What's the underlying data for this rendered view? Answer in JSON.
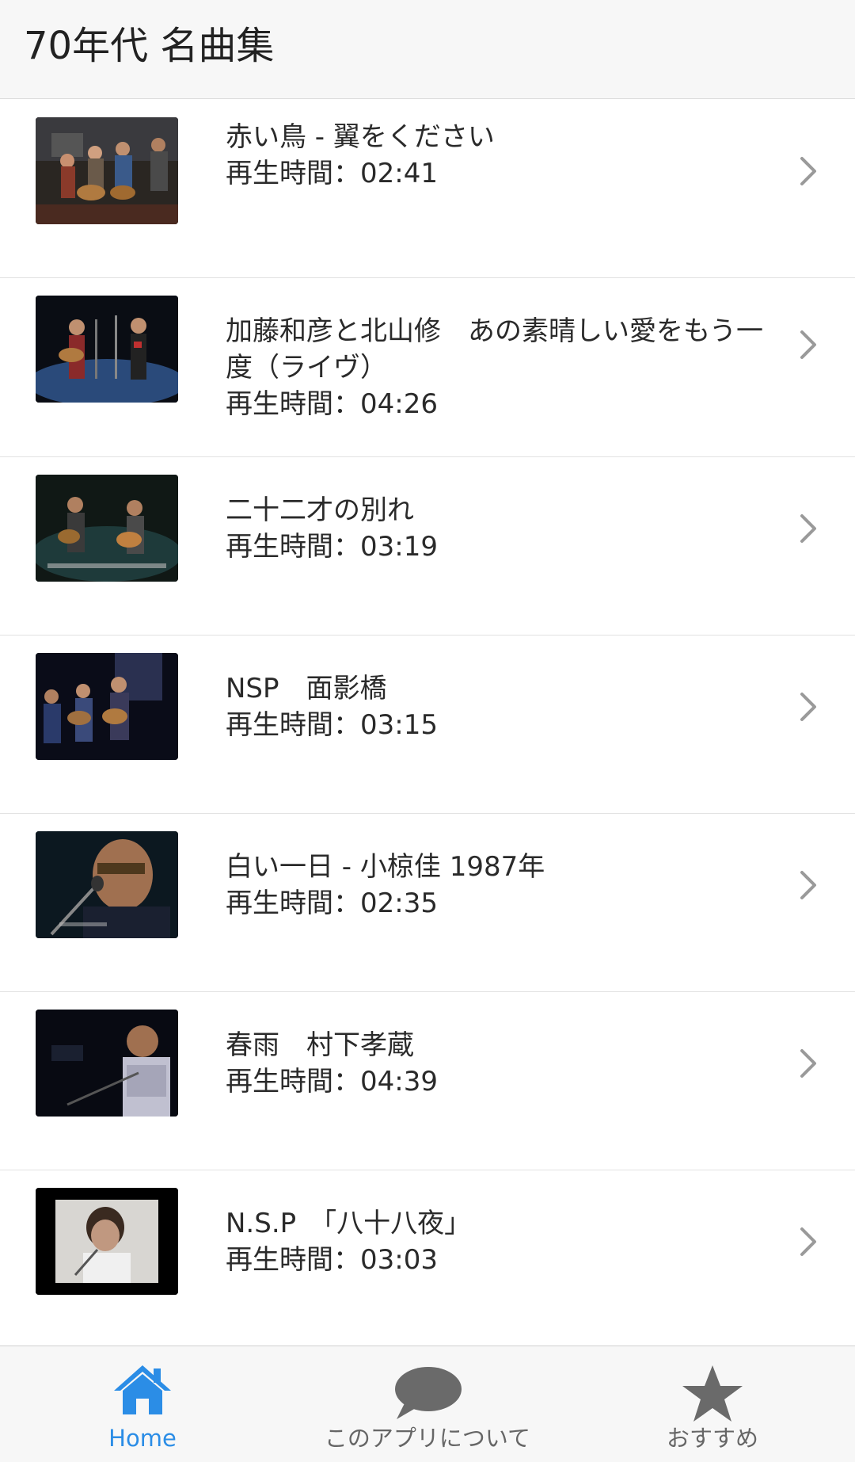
{
  "header": {
    "title": "70年代 名曲集"
  },
  "items": [
    {
      "title": "赤い鳥 - 翼をください",
      "duration": "再生時間：02:41"
    },
    {
      "title": "加藤和彦と北山修　あの素晴しい愛をもう一度（ライヴ）",
      "duration": "再生時間：04:26"
    },
    {
      "title": "二十二才の別れ",
      "duration": "再生時間：03:19"
    },
    {
      "title": "NSP　面影橋",
      "duration": "再生時間：03:15"
    },
    {
      "title": "白い一日 - 小椋佳 1987年",
      "duration": "再生時間：02:35"
    },
    {
      "title": "春雨　村下孝蔵",
      "duration": "再生時間：04:39"
    },
    {
      "title": "N.S.P　「八十八夜」",
      "duration": "再生時間：03:03"
    }
  ],
  "tabbar": {
    "tabs": [
      {
        "label": "Home",
        "icon": "home-icon",
        "active": true
      },
      {
        "label": "このアプリについて",
        "icon": "speech-bubble-icon",
        "active": false
      },
      {
        "label": "おすすめ",
        "icon": "star-icon",
        "active": false
      }
    ]
  },
  "colors": {
    "accent": "#2b8de6",
    "header_bg": "#f7f7f7",
    "tab_inactive": "#666666",
    "chevron": "#9a9a9a"
  }
}
